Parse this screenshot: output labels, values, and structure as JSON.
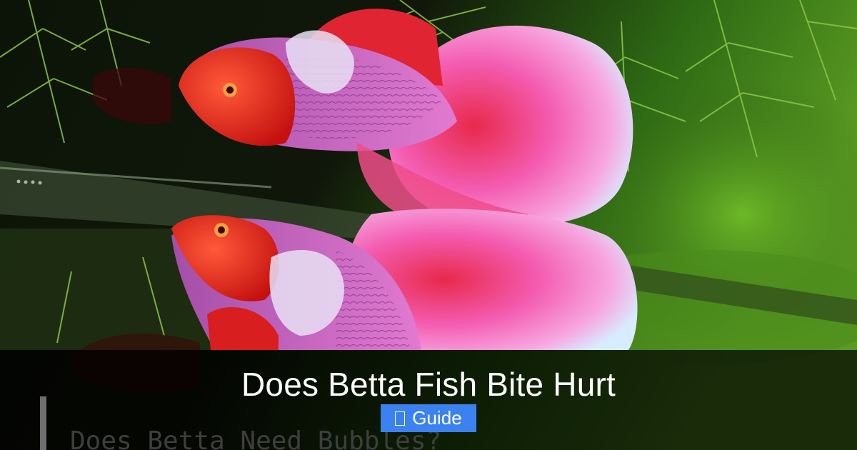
{
  "caption": {
    "title": "Does Betta Fish Bite Hurt",
    "badge_icon": "document-icon",
    "badge_label": "Guide"
  },
  "background_text": "Does Betta Need Bubbles?",
  "colors": {
    "badge": "#3b82f0",
    "caption_bar": "#000000",
    "fish_red": "#e8221f",
    "fin_pink": "#f25bb4",
    "plant_green": "#6fa62a"
  }
}
